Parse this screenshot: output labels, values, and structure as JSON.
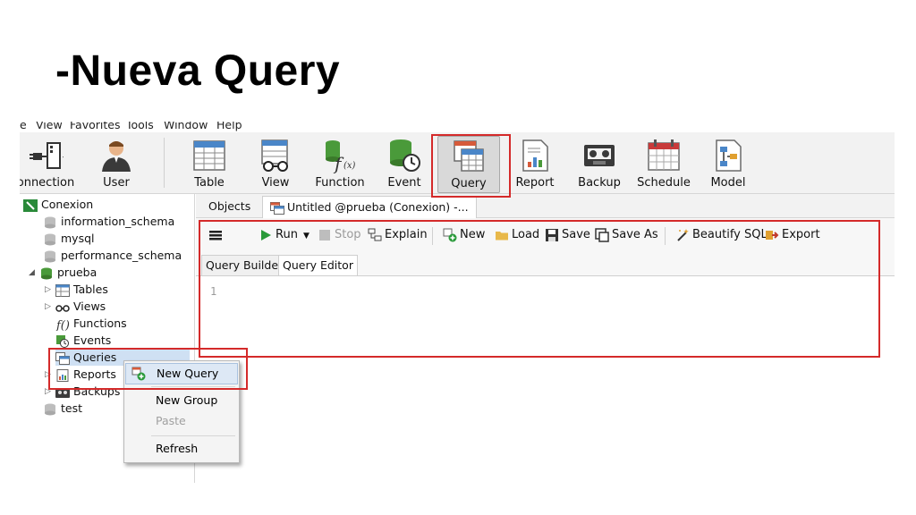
{
  "slide": {
    "title": "-Nueva Query"
  },
  "menu": [
    "e",
    "View",
    "Favorites",
    "Tools",
    "Window",
    "Help"
  ],
  "toolbar": [
    {
      "label": "onnection",
      "icon": "connection-icon"
    },
    {
      "label": "User",
      "icon": "user-icon"
    },
    {
      "label": "Table",
      "icon": "table-icon"
    },
    {
      "label": "View",
      "icon": "view-icon"
    },
    {
      "label": "Function",
      "icon": "function-icon"
    },
    {
      "label": "Event",
      "icon": "event-icon"
    },
    {
      "label": "Query",
      "icon": "query-icon",
      "selected": true
    },
    {
      "label": "Report",
      "icon": "report-icon"
    },
    {
      "label": "Backup",
      "icon": "backup-icon"
    },
    {
      "label": "Schedule",
      "icon": "schedule-icon"
    },
    {
      "label": "Model",
      "icon": "model-icon"
    }
  ],
  "tabs": [
    {
      "label": "Objects"
    },
    {
      "label": "Untitled @prueba (Conexion) -..."
    }
  ],
  "sidebar": {
    "connection": "Conexion",
    "databases": [
      "information_schema",
      "mysql",
      "performance_schema",
      "prueba"
    ],
    "prueba_children": [
      "Tables",
      "Views",
      "Functions",
      "Events",
      "Queries",
      "Reports",
      "Backups"
    ],
    "last_db": "test"
  },
  "query_toolbar": {
    "run": "Run",
    "stop": "Stop",
    "explain": "Explain",
    "new": "New",
    "load": "Load",
    "save": "Save",
    "save_as": "Save As",
    "beautify": "Beautify SQL",
    "export": "Export"
  },
  "subtabs": [
    "Query Builder",
    "Query Editor"
  ],
  "editor": {
    "line_number": "1"
  },
  "context_menu": {
    "items": [
      "New Query",
      "New Group",
      "Paste",
      "Refresh"
    ],
    "disabled": [
      "Paste"
    ],
    "highlighted": "New Query"
  },
  "colors": {
    "highlight_red": "#d42a2a",
    "db_green": "#4a9a3a",
    "accent_blue": "#2f6fb5"
  }
}
